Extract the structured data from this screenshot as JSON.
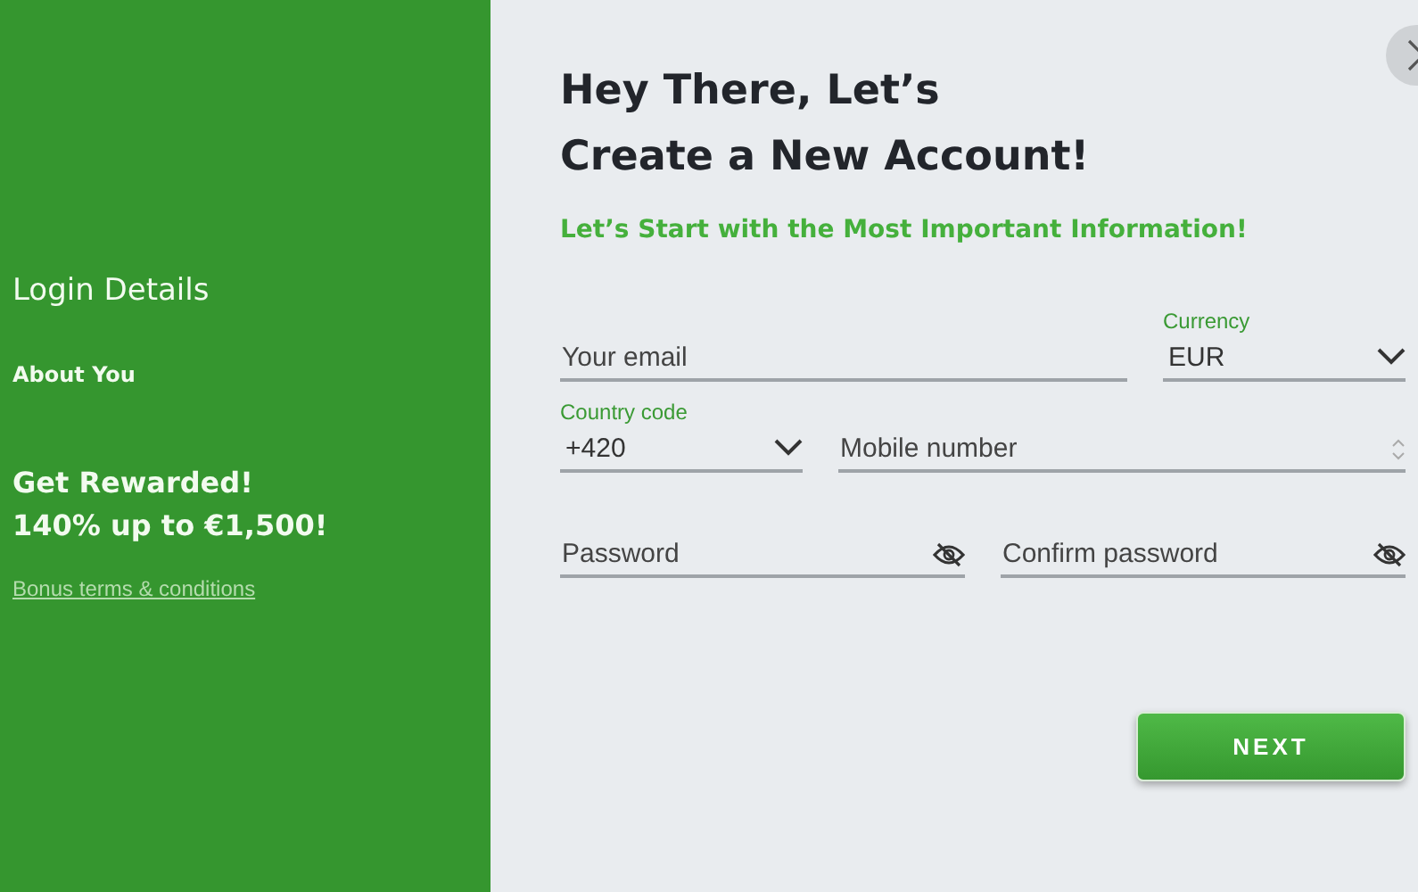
{
  "sidebar": {
    "steps": [
      {
        "label": "Login Details",
        "selected": true
      },
      {
        "label": "About You",
        "selected": false
      }
    ],
    "promo": {
      "title": "Get Rewarded!",
      "offer": "140% up to €1,500!"
    },
    "link": "Bonus terms & conditions"
  },
  "form": {
    "title_lines": [
      "Hey There, Let’s",
      "Create a New Account!"
    ],
    "subtitle": "Let’s Start with the Most Important Information!",
    "rows": [
      [
        {
          "kind": "text",
          "placeholder": "Your email"
        },
        {
          "kind": "select",
          "label": "Currency",
          "value": "EUR"
        }
      ],
      [
        {
          "kind": "select",
          "label": "Country code",
          "value": "+420"
        },
        {
          "kind": "number",
          "placeholder": "Mobile number"
        }
      ],
      [
        {
          "kind": "password",
          "placeholder": "Password"
        },
        {
          "kind": "password",
          "placeholder": "Confirm password"
        }
      ]
    ],
    "button": "NEXT"
  }
}
